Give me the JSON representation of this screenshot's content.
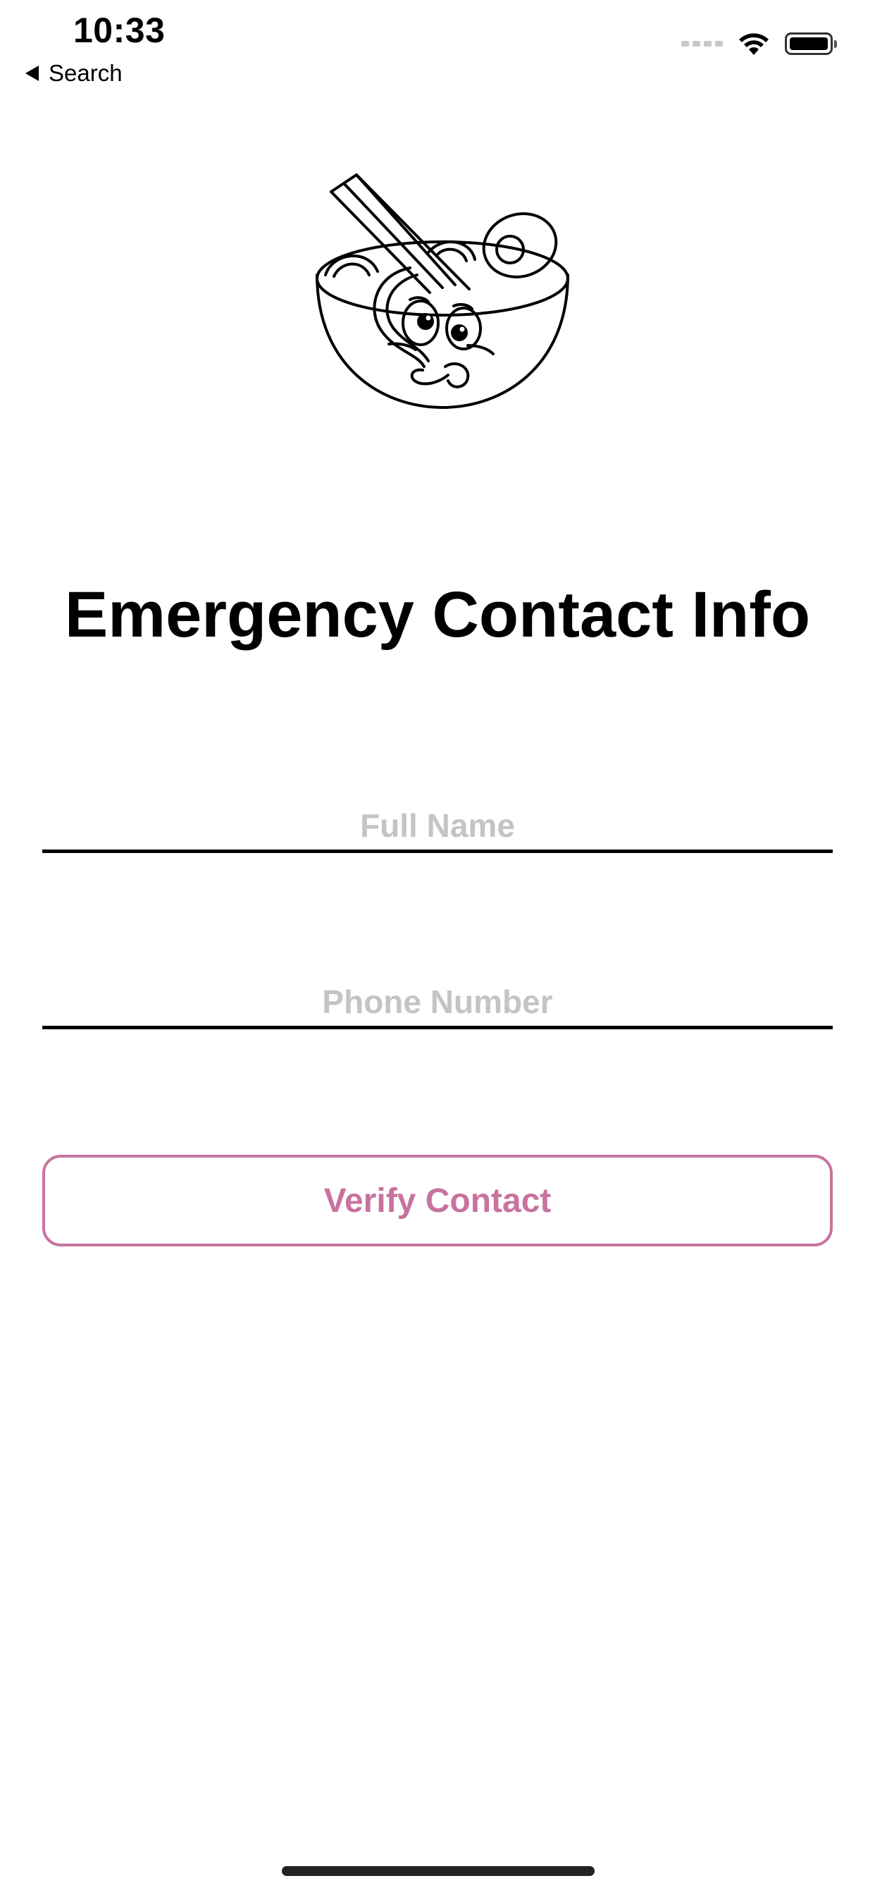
{
  "status_bar": {
    "time": "10:33",
    "back_label": "Search",
    "icons": [
      "cellular-signal-icon",
      "wifi-icon",
      "battery-icon"
    ]
  },
  "logo": {
    "icon": "ramen-bowl-mascot-icon"
  },
  "page": {
    "title": "Emergency Contact Info"
  },
  "form": {
    "full_name": {
      "value": "",
      "placeholder": "Full Name"
    },
    "phone_number": {
      "value": "",
      "placeholder": "Phone Number"
    }
  },
  "actions": {
    "verify_label": "Verify Contact"
  },
  "colors": {
    "accent": "#c8729f",
    "placeholder": "#c4c4c4",
    "text": "#000000",
    "background": "#ffffff"
  }
}
